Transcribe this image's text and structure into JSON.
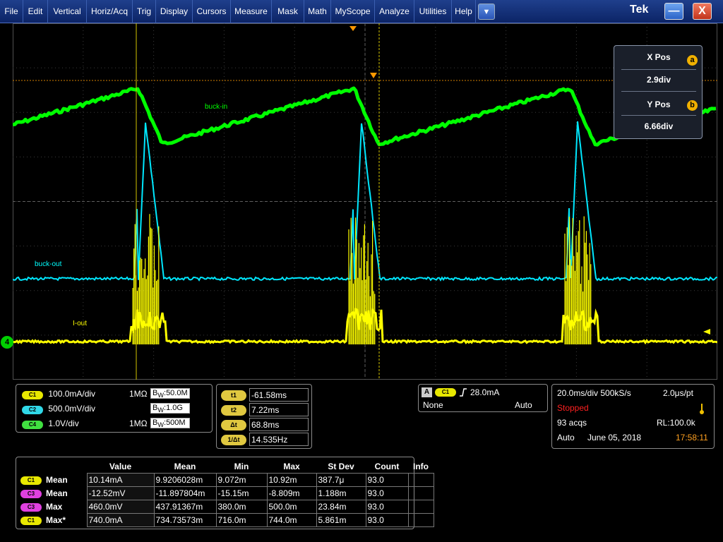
{
  "menubar": {
    "items": [
      "File",
      "Edit",
      "Vertical",
      "Horiz/Acq",
      "Trig",
      "Display",
      "Cursors",
      "Measure",
      "Mask",
      "Math",
      "MyScope",
      "Analyze",
      "Utilities",
      "Help"
    ],
    "dropdown_icon": "chevron-down-icon",
    "brand": "Tek",
    "minimize_symbol": "—",
    "close_symbol": "X"
  },
  "traces": {
    "buck_in_label": "buck-in",
    "buck_out_label": "buck-out",
    "i_out_label": "I-out",
    "ch4_marker": "4",
    "colors": {
      "ch1": "#ffff00",
      "ch2": "#00ffff",
      "ch3": "#ff00ff",
      "ch4": "#00ff00",
      "cursor": "#d4c400",
      "trigger": "#ff9900"
    }
  },
  "cursor_popup": {
    "xpos_title": "X Pos",
    "xpos_value": "2.9div",
    "xpos_badge": "a",
    "ypos_title": "Y Pos",
    "ypos_value": "6.66div",
    "ypos_badge": "b"
  },
  "channels": [
    {
      "chip": "C1",
      "scale": "100.0mA/div",
      "coupling": "1MΩ",
      "bw": "50.0M"
    },
    {
      "chip": "C2",
      "scale": "500.0mV/div",
      "coupling": "",
      "bw": "1.0G"
    },
    {
      "chip": "C4",
      "scale": "1.0V/div",
      "coupling": "1MΩ",
      "bw": "500M"
    }
  ],
  "bw_prefix": "B",
  "bw_sub": "W",
  "cursors": [
    {
      "button": "t1",
      "value": "-61.58ms"
    },
    {
      "button": "t2",
      "value": "7.22ms"
    },
    {
      "button": "Δt",
      "value": "68.8ms"
    },
    {
      "button": "1/Δt",
      "value": "14.535Hz"
    }
  ],
  "trigger": {
    "mode_badge": "A",
    "source": "C1",
    "slope_icon": "rising-edge-icon",
    "level": "28.0mA",
    "coupling": "None",
    "mode": "Auto"
  },
  "acquisition": {
    "timebase": "20.0ms/div 500kS/s",
    "resolution": "2.0μs/pt",
    "state": "Stopped",
    "acqs": "93 acqs",
    "record_length": "RL:100.0k",
    "mode": "Auto",
    "date": "June 05, 2018",
    "time": "17:58:11",
    "thermometer_icon": "thermometer-icon"
  },
  "measurements": {
    "headers": [
      "Value",
      "Mean",
      "Min",
      "Max",
      "St Dev",
      "Count",
      "Info"
    ],
    "rows": [
      {
        "source": "C1",
        "type": "Mean",
        "value": "10.14mA",
        "mean": "9.9206028m",
        "min": "9.072m",
        "max": "10.92m",
        "stdev": "387.7μ",
        "count": "93.0",
        "info": ""
      },
      {
        "source": "C3",
        "type": "Mean",
        "value": "-12.52mV",
        "mean": "-11.897804m",
        "min": "-15.15m",
        "max": "-8.809m",
        "stdev": "1.188m",
        "count": "93.0",
        "info": ""
      },
      {
        "source": "C3",
        "type": "Max",
        "value": "460.0mV",
        "mean": "437.91367m",
        "min": "380.0m",
        "max": "500.0m",
        "stdev": "23.84m",
        "count": "93.0",
        "info": ""
      },
      {
        "source": "C1",
        "type": "Max*",
        "value": "740.0mA",
        "mean": "734.73573m",
        "min": "716.0m",
        "max": "744.0m",
        "stdev": "5.861m",
        "count": "93.0",
        "info": ""
      }
    ]
  }
}
